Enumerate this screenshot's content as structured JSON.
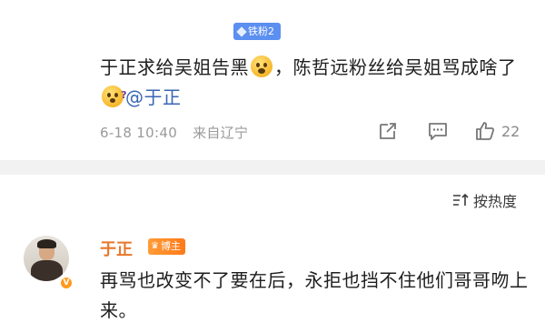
{
  "post": {
    "fan_badge": "铁粉2",
    "text_part1": "于正求给吴姐告黑",
    "text_part2": "，陈哲远粉丝给吴姐骂成啥了",
    "mention": "@于正",
    "time": "6-18 10:40",
    "location": "来自辽宁",
    "like_count": "22",
    "emoji_1": "scream-face-emoji",
    "emoji_2": "confused-face-emoji"
  },
  "sort": {
    "label": "按热度"
  },
  "comment": {
    "author": "于正",
    "author_badge": "博主",
    "verified_badge": "V",
    "text": "再骂也改变不了要在后，永拒也挡不住他们哥哥吻上来。"
  },
  "colors": {
    "accent_name": "#e8772b",
    "fan_badge_bg": "#5b8ff0",
    "mention": "#3a66b5",
    "meta": "#9a9a9a",
    "divider": "#f2f2f2"
  }
}
